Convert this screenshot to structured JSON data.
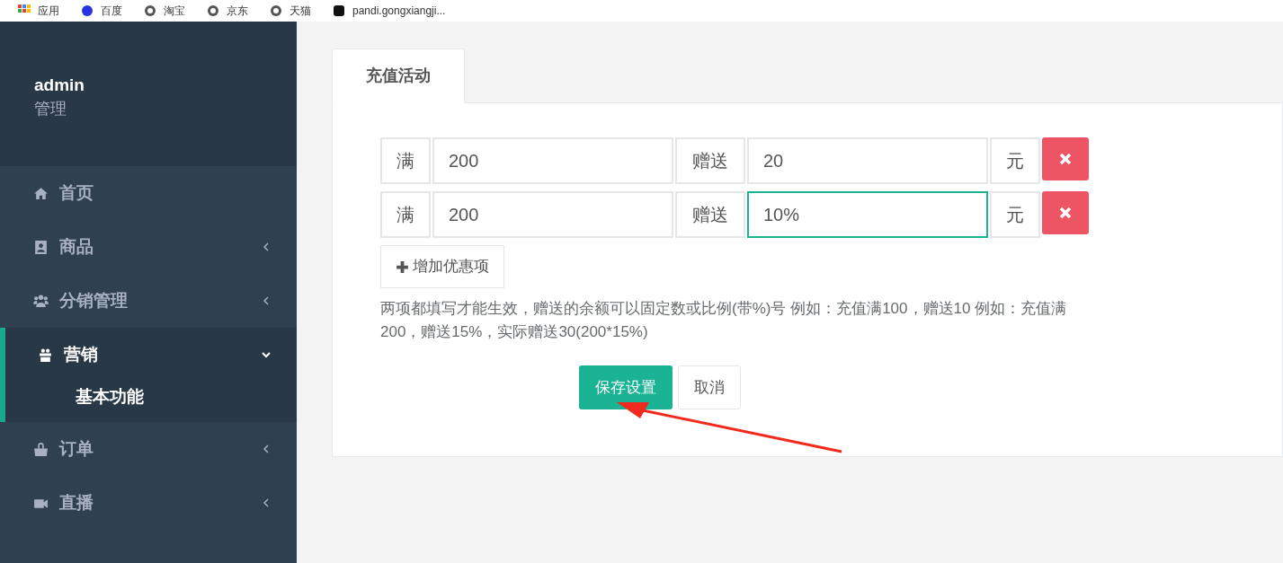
{
  "bookmarks": [
    {
      "label": "应用"
    },
    {
      "label": "百度"
    },
    {
      "label": "淘宝"
    },
    {
      "label": "京东"
    },
    {
      "label": "天猫"
    },
    {
      "label": "pandi.gongxiangji..."
    }
  ],
  "sidebar": {
    "user": {
      "name": "admin",
      "role": "管理"
    },
    "items": [
      {
        "label": "首页",
        "kind": "link",
        "selected": false
      },
      {
        "label": "商品",
        "kind": "menu",
        "expanded": false,
        "selected": false
      },
      {
        "label": "分销管理",
        "kind": "menu",
        "expanded": false,
        "selected": false
      },
      {
        "label": "营销",
        "kind": "menu",
        "expanded": true,
        "selected": true,
        "children": [
          {
            "label": "基本功能",
            "selected": true
          }
        ]
      },
      {
        "label": "订单",
        "kind": "menu",
        "expanded": false,
        "selected": false
      },
      {
        "label": "直播",
        "kind": "menu",
        "expanded": false,
        "selected": false
      }
    ]
  },
  "tabs": [
    {
      "label": "充值活动",
      "selected": true
    }
  ],
  "rules": [
    {
      "prefix": "满",
      "threshold": "200",
      "give_label": "赠送",
      "amount": "20",
      "unit": "元",
      "focused": false
    },
    {
      "prefix": "满",
      "threshold": "200",
      "give_label": "赠送",
      "amount": "10%",
      "unit": "元",
      "focused": true
    }
  ],
  "add_button": "增加优惠项",
  "help_text": "两项都填写才能生效，赠送的余额可以固定数或比例(带%)号 例如：充值满100，赠送10 例如：充值满200，赠送15%，实际赠送30(200*15%)",
  "save_button": "保存设置",
  "cancel_button": "取消"
}
